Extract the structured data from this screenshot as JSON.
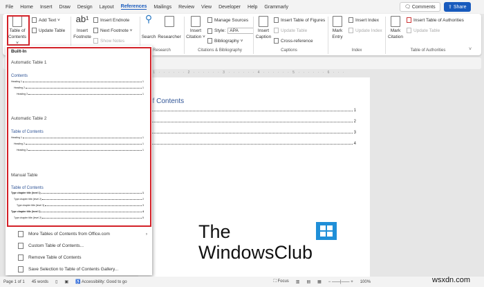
{
  "tabs": [
    "File",
    "Home",
    "Insert",
    "Draw",
    "Design",
    "Layout",
    "References",
    "Mailings",
    "Review",
    "View",
    "Developer",
    "Help",
    "Grammarly"
  ],
  "active_tab": "References",
  "top": {
    "comments": "Comments",
    "share": "Share"
  },
  "ribbon": {
    "toc": {
      "label1": "Table of",
      "label2": "Contents ˅",
      "add_text": "Add Text ˅",
      "update_table": "Update Table"
    },
    "footnotes": {
      "insert1": "Insert",
      "insert2": "Footnote",
      "insert_endnote": "Insert Endnote",
      "next_footnote": "Next Footnote ˅",
      "show_notes": "Show Notes"
    },
    "research": {
      "search": "Search",
      "researcher": "Researcher",
      "label": "Research"
    },
    "citations": {
      "insert1": "Insert",
      "insert2": "Citation ˅",
      "manage": "Manage Sources",
      "style_label": "Style:",
      "style_value": "APA",
      "bibliography": "Bibliography ˅",
      "label": "Citations & Bibliography"
    },
    "captions": {
      "insert1": "Insert",
      "insert2": "Caption",
      "table_figures": "Insert Table of Figures",
      "update_table": "Update Table",
      "cross_ref": "Cross-reference",
      "label": "Captions"
    },
    "index": {
      "mark1": "Mark",
      "mark2": "Entry",
      "insert_index": "Insert Index",
      "update_index": "Update Index",
      "label": "Index"
    },
    "authorities": {
      "mark1": "Mark",
      "mark2": "Citation",
      "insert": "Insert Table of Authorities",
      "update": "Update Table",
      "label": "Table of Authorities"
    }
  },
  "ruler": "· · · 1 · · · · · · 2 · · · · · · 3 · · · · · · 4 · · · · · · 5 · · · · · · 6 · · · ",
  "document": {
    "title": "of Contents",
    "lines": [
      {
        "n": "1",
        "p": "1"
      },
      {
        "n": "2",
        "p": "2"
      },
      {
        "n": "3",
        "p": "3"
      },
      {
        "n": "4",
        "p": "4"
      }
    ]
  },
  "menu": {
    "builtin": "Built-In",
    "auto1": {
      "name": "Automatic Table 1",
      "title": "Contents",
      "lines": [
        {
          "t": "Heading 1",
          "p": "1"
        },
        {
          "t": "Heading 2",
          "p": "1"
        },
        {
          "t": "Heading 3",
          "p": "1"
        }
      ]
    },
    "auto2": {
      "name": "Automatic Table 2",
      "title": "Table of Contents",
      "lines": [
        {
          "t": "Heading 1",
          "p": "1"
        },
        {
          "t": "Heading 2",
          "p": "1"
        },
        {
          "t": "Heading 3",
          "p": "1"
        }
      ]
    },
    "manual": {
      "name": "Manual Table",
      "title": "Table of Contents",
      "lines": [
        {
          "t": "Type chapter title (level 1)",
          "p": "1"
        },
        {
          "t": "Type chapter title (level 2)",
          "p": "2"
        },
        {
          "t": "Type chapter title (level 3)",
          "p": "3"
        },
        {
          "t": "Type chapter title (level 1)",
          "p": "4"
        },
        {
          "t": "Type chapter title (level 2)",
          "p": "5"
        }
      ]
    },
    "items": [
      "More Tables of Contents from Office.com",
      "Custom Table of Contents...",
      "Remove Table of Contents",
      "Save Selection to Table of Contents Gallery..."
    ]
  },
  "logo": {
    "line1": "The",
    "line2": "WindowsClub"
  },
  "status": {
    "page": "Page 1 of 1",
    "words": "45 words",
    "accessibility": "Accessibility: Good to go",
    "focus": "Focus",
    "zoom": "100%"
  },
  "watermark": "wsxdn.com"
}
